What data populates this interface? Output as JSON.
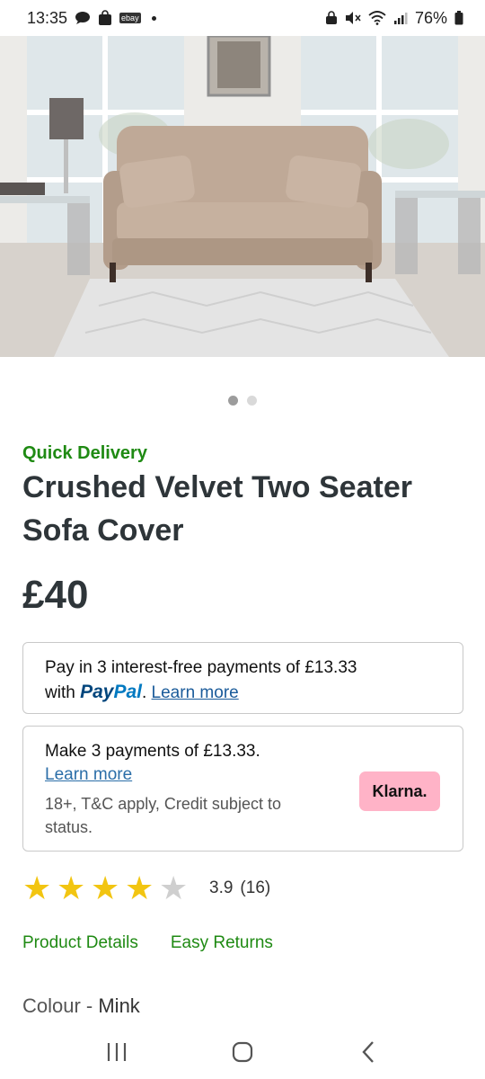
{
  "status_bar": {
    "time": "13:35",
    "ebay_label": "ebay",
    "battery": "76%"
  },
  "carousel": {
    "total": 2,
    "active": 1
  },
  "product": {
    "delivery_tag": "Quick Delivery",
    "title": "Crushed Velvet Two Seater Sofa Cover",
    "price": "£40"
  },
  "paypal": {
    "line1": "Pay in 3 interest-free payments of £13.33",
    "with": "with ",
    "brand_pay": "Pay",
    "brand_pal": "Pal",
    "period": ".",
    "learn_more": "Learn more"
  },
  "klarna": {
    "line1": "Make 3 payments of £13.33.",
    "learn_more": "Learn more",
    "fine_print": "18+, T&C apply, Credit subject to status.",
    "badge": "Klarna."
  },
  "rating": {
    "value": 3.9,
    "text": "3.9",
    "count": "(16)",
    "stars_filled": 4,
    "stars_total": 5
  },
  "tabs": {
    "product_details": "Product Details",
    "easy_returns": "Easy Returns"
  },
  "colour": {
    "label": "Colour - ",
    "value": "Mink"
  },
  "colors": {
    "accent_green": "#1f8a13",
    "star_gold": "#f2c511",
    "klarna_pink": "#ffb3c7"
  }
}
